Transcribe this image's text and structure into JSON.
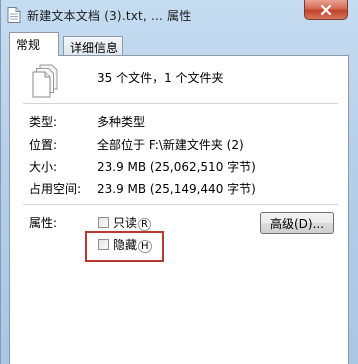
{
  "window": {
    "title": "新建文本文档 (3).txt, ... 属性",
    "close_glyph": "x"
  },
  "tabs": [
    {
      "label": "常规",
      "selected": true
    },
    {
      "label": "详细信息",
      "selected": false
    }
  ],
  "summary": {
    "text": "35 个文件，1 个文件夹"
  },
  "properties": [
    {
      "label": "类型:",
      "value": "多种类型"
    },
    {
      "label": "位置:",
      "value": "全部位于 F:\\新建文件夹 (2)"
    },
    {
      "label": "大小:",
      "value": "23.9 MB (25,062,510 字节)"
    },
    {
      "label": "占用空间:",
      "value": "23.9 MB (25,149,440 字节)"
    }
  ],
  "attributes": {
    "label": "属性:",
    "readonly": {
      "text": "只读",
      "accel": "R",
      "checked": false
    },
    "hidden": {
      "text": "隐藏",
      "accel": "H",
      "checked": false
    },
    "advanced_button": "高级(D)..."
  }
}
